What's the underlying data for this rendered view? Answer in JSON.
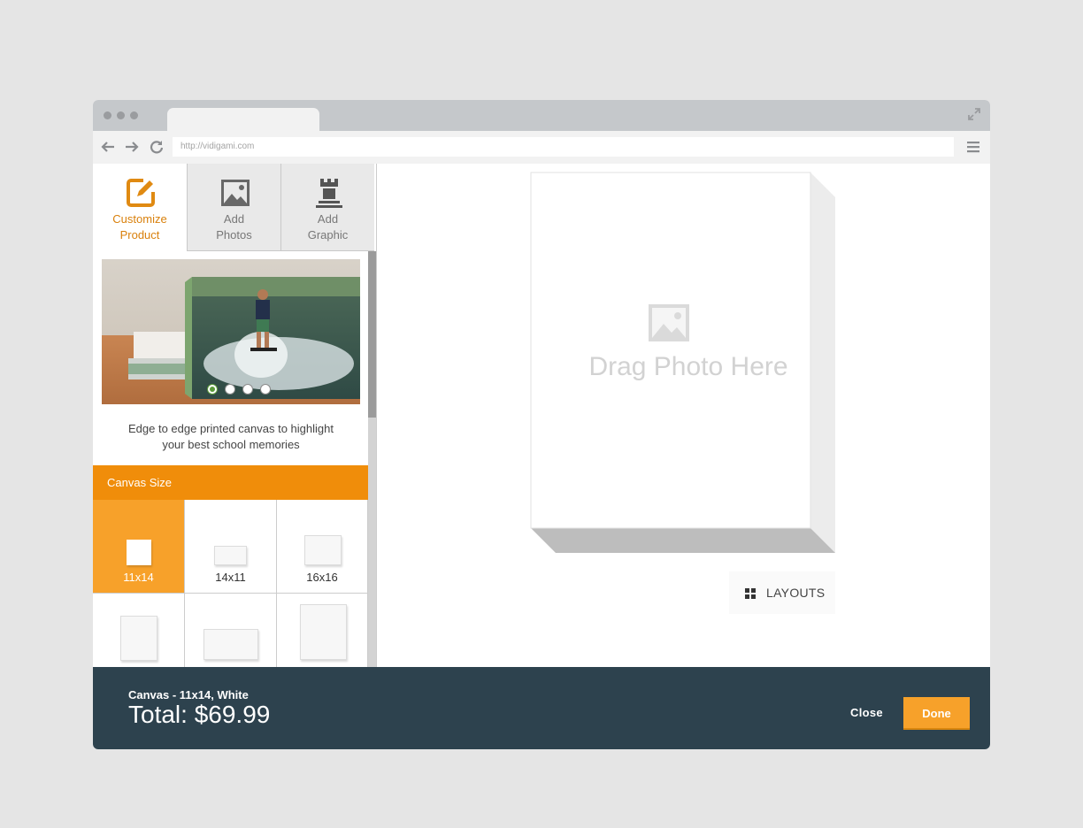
{
  "browser": {
    "url": "http://vidigami.com"
  },
  "sidebar": {
    "tabs": [
      {
        "label_line1": "Customize",
        "label_line2": "Product",
        "icon": "edit-icon"
      },
      {
        "label_line1": "Add",
        "label_line2": "Photos",
        "icon": "image-icon"
      },
      {
        "label_line1": "Add",
        "label_line2": "Graphic",
        "icon": "rook-icon"
      }
    ],
    "description_line1": "Edge to edge printed canvas to highlight",
    "description_line2": "your best school memories",
    "carousel": {
      "count": 4,
      "active_index": 0
    },
    "size_section_title": "Canvas Size",
    "sizes": [
      {
        "label": "11x14",
        "selected": true
      },
      {
        "label": "14x11",
        "selected": false
      },
      {
        "label": "16x16",
        "selected": false
      },
      {
        "label": "",
        "selected": false
      },
      {
        "label": "",
        "selected": false
      },
      {
        "label": "",
        "selected": false
      }
    ]
  },
  "canvas": {
    "placeholder": "Drag Photo Here",
    "layouts_label": "LAYOUTS"
  },
  "footer": {
    "product": "Canvas - 11x14, White",
    "total": "Total: $69.99",
    "close_label": "Close",
    "done_label": "Done"
  },
  "colors": {
    "accent": "#f08d0a",
    "selected": "#f7a12a",
    "footer_bg": "#2d424e",
    "active_tab_text": "#d9800c"
  }
}
